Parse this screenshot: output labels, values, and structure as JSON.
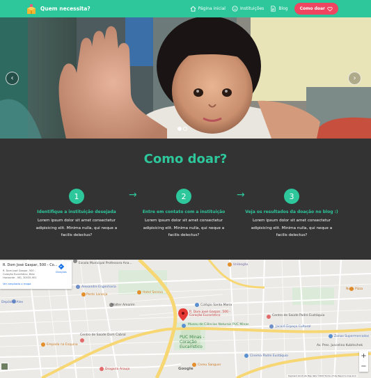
{
  "navbar": {
    "brand": "Quem necessita?",
    "links": [
      {
        "label": "Página inicial",
        "icon": "home-icon"
      },
      {
        "label": "Instituições",
        "icon": "smile-icon"
      },
      {
        "label": "Blog",
        "icon": "document-icon"
      }
    ],
    "donate_label": "Como doar",
    "donate_icon": "heart-icon",
    "colors": {
      "accent": "#2ec79b",
      "donate": "#ef4560"
    }
  },
  "carousel": {
    "prev_icon": "chevron-left-icon",
    "next_icon": "chevron-right-icon",
    "slides": 2,
    "active_slide": 1,
    "prev_glyph": "‹",
    "next_glyph": "›"
  },
  "how": {
    "title": "Como doar?",
    "arrow_glyph": "→",
    "steps": [
      {
        "number": "1",
        "title": "Identifique a instituição desejada",
        "text": "Lorem ipsum dolor sit amet consectetur adipisicing elit. Minima nulla, qui neque a facilis delectus?"
      },
      {
        "number": "2",
        "title": "Entre em contato com a instituição",
        "text": "Lorem ipsum dolor sit amet consectetur adipisicing elit. Minima nulla, qui neque a facilis delectus?"
      },
      {
        "number": "3",
        "title": "Veja os resultados da doação no blog :)",
        "text": "Lorem ipsum dolor sit amet consectetur adipisicing elit. Minima nulla, qui neque a facilis delectus?"
      }
    ]
  },
  "map": {
    "info_title": "R. Dom José Gaspar, 500 - Co...",
    "info_address": "R. Dom José Gaspar, 500 - Coração Eucarístico, Belo Horizonte - MG, 30535-901",
    "info_link": "Ver ampliado o mapa",
    "directions": "Direções",
    "marker_label": "R. Dom José Gaspar, 500 - Coração Eucarístico",
    "place_label": "PUC Minas - Coração Eucarístico",
    "labels": [
      "Escola Municipal Professora Ana...",
      "Alexandre Engenharia",
      "Posto Laranja",
      "Walter Amorim",
      "Depósito Alex",
      "Hotel Sereno",
      "Colégio Santa Maria",
      "Museu de Ciências Naturais PUC Minas",
      "Jacaré Espaço Cultural",
      "Centro de Saúde Padre Eustáquio",
      "Centro de Saúde Dom Cabral",
      "Drogaria Araujo",
      "Coreu Sanguer",
      "Cinema Padre Eustáquio",
      "Zonas Supermercados",
      "Av. Pres. Juscelino Kubitschek",
      "Nova Pizza",
      "Unibegão",
      "Empada na Esquina"
    ],
    "footer": "Keyboard shortcuts   Map data ©2023   Terms of Use   Report a map error",
    "google": "Google",
    "zoom_in": "+",
    "zoom_out": "−"
  }
}
